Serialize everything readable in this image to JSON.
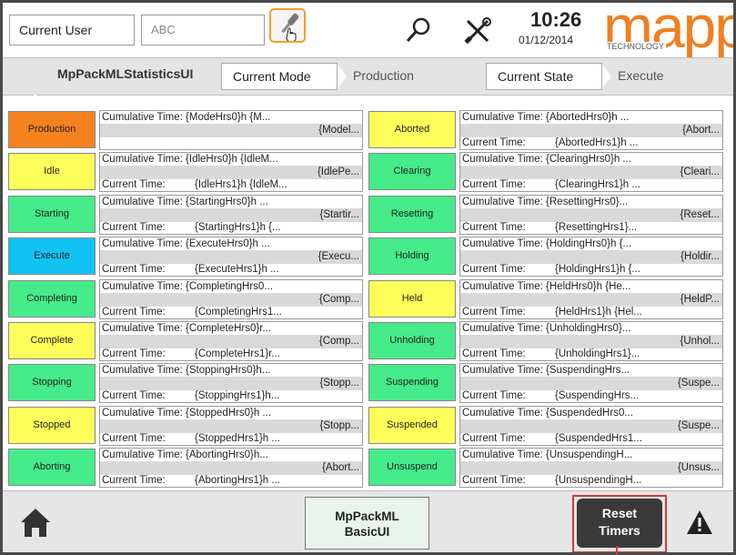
{
  "topbar": {
    "user_label": "Current User",
    "user_value": "ABC",
    "time": "10:26",
    "date": "01/12/2014",
    "logo_text": "mapp",
    "logo_sub": "TECHNOLOGY",
    "icons": [
      "key-login-icon",
      "search-icon",
      "tools-icon"
    ]
  },
  "header": {
    "title": "MpPackMLStatisticsUI",
    "mode_label": "Current Mode",
    "mode_value": "Production",
    "state_label": "Current State",
    "state_value": "Execute"
  },
  "colors": {
    "orange": "#f5811f",
    "yellow": "#fefe5a",
    "green": "#46eb8a",
    "blue": "#12c2f2",
    "accent_red": "#d0393e"
  },
  "left_cells": [
    {
      "name": "Production",
      "color": "orange",
      "cum": "Cumulative Time: {ModeHrs0}h {M...",
      "val": "{Model...",
      "cur": ""
    },
    {
      "name": "Idle",
      "color": "yellow",
      "cum": "Cumulative Time: {IdleHrs0}h {IdleM...",
      "val": "{IdlePe...",
      "cur": "{IdleHrs1}h {IdleM..."
    },
    {
      "name": "Starting",
      "color": "green",
      "cum": "Cumulative Time: {StartingHrs0}h ...",
      "val": "{Startir...",
      "cur": "{StartingHrs1}h {..."
    },
    {
      "name": "Execute",
      "color": "blue",
      "cum": "Cumulative Time: {ExecuteHrs0}h ...",
      "val": "{Execu...",
      "cur": "{ExecuteHrs1}h ..."
    },
    {
      "name": "Completing",
      "color": "green",
      "cum": "Cumulative Time: {CompletingHrs0...",
      "val": "{Comp...",
      "cur": "{CompletingHrs1..."
    },
    {
      "name": "Complete",
      "color": "yellow",
      "cum": "Cumulative Time: {CompleteHrs0}r...",
      "val": "{Comp...",
      "cur": "{CompleteHrs1}r..."
    },
    {
      "name": "Stopping",
      "color": "green",
      "cum": "Cumulative Time: {StoppingHrs0}h...",
      "val": "{Stopp...",
      "cur": "{StoppingHrs1}h..."
    },
    {
      "name": "Stopped",
      "color": "yellow",
      "cum": "Cumulative Time: {StoppedHrs0}h ...",
      "val": "{Stopp...",
      "cur": "{StoppedHrs1}h ..."
    },
    {
      "name": "Aborting",
      "color": "green",
      "cum": "Cumulative Time: {AbortingHrs0}h...",
      "val": "{Abort...",
      "cur": "{AbortingHrs1}h ..."
    }
  ],
  "right_cells": [
    {
      "name": "Aborted",
      "color": "yellow",
      "cum": "Cumulative Time: {AbortedHrs0}h ...",
      "val": "{Abort...",
      "cur": "{AbortedHrs1}h ..."
    },
    {
      "name": "Clearing",
      "color": "green",
      "cum": "Cumulative Time: {ClearingHrs0}h ...",
      "val": "{Cleari...",
      "cur": "{ClearingHrs1}h ..."
    },
    {
      "name": "Resetting",
      "color": "green",
      "cum": "Cumulative Time: {ResettingHrs0}...",
      "val": "{Reset...",
      "cur": "{ResettingHrs1}..."
    },
    {
      "name": "Holding",
      "color": "green",
      "cum": "Cumulative Time: {HoldingHrs0}h {...",
      "val": "{Holdir...",
      "cur": "{HoldingHrs1}h {..."
    },
    {
      "name": "Held",
      "color": "yellow",
      "cum": "Cumulative Time: {HeldHrs0}h {He...",
      "val": "{HeldP...",
      "cur": "{HeldHrs1}h {Hel..."
    },
    {
      "name": "Unholding",
      "color": "green",
      "cum": "Cumulative Time: {UnholdingHrs0}...",
      "val": "{Unhol...",
      "cur": "{UnholdingHrs1}..."
    },
    {
      "name": "Suspending",
      "color": "green",
      "cum": "Cumulative Time: {SuspendingHrs...",
      "val": "{Suspe...",
      "cur": "{SuspendingHrs..."
    },
    {
      "name": "Suspended",
      "color": "yellow",
      "cum": "Cumulative Time: {SuspendedHrs0...",
      "val": "{Suspe...",
      "cur": "{SuspendedHrs1..."
    },
    {
      "name": "Unsuspend",
      "color": "green",
      "cum": "Cumulative Time: {UnsuspendingH...",
      "val": "{Unsus...",
      "cur": "{UnsuspendingH..."
    }
  ],
  "current_time_label": "Current Time:",
  "footer": {
    "basic_line1": "MpPackML",
    "basic_line2": "BasicUI",
    "reset_line1": "Reset",
    "reset_line2": "Timers",
    "icons": [
      "home-icon",
      "warning-icon"
    ]
  }
}
